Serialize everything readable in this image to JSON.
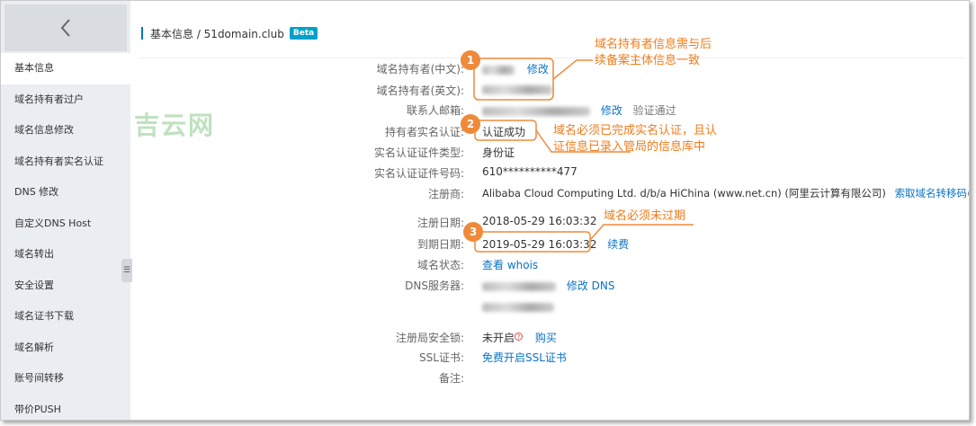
{
  "sidebar": {
    "back_icon": "chevron-left-icon",
    "items": [
      {
        "label": "基本信息"
      },
      {
        "label": "域名持有者过户"
      },
      {
        "label": "域名信息修改"
      },
      {
        "label": "域名持有者实名认证"
      },
      {
        "label": "DNS 修改"
      },
      {
        "label": "自定义DNS Host"
      },
      {
        "label": "域名转出"
      },
      {
        "label": "安全设置"
      },
      {
        "label": "域名证书下载"
      },
      {
        "label": "域名解析"
      },
      {
        "label": "账号间转移"
      },
      {
        "label": "带价PUSH"
      }
    ],
    "collapse_icon": "collapse-icon"
  },
  "watermark": "吉云网",
  "breadcrumb": {
    "text": "基本信息 / 51domain.club",
    "badge": "Beta"
  },
  "fields": {
    "owner_cn": {
      "label": "域名持有者(中文):",
      "action": "修改"
    },
    "owner_en": {
      "label": "域名持有者(英文):"
    },
    "email": {
      "label": "联系人邮箱:",
      "action": "修改",
      "status": "验证通过"
    },
    "realname": {
      "label": "持有者实名认证:",
      "value": "认证成功"
    },
    "cert_type": {
      "label": "实名认证证件类型:",
      "value": "身份证"
    },
    "cert_no": {
      "label": "实名认证证件号码:",
      "value": "610**********477"
    },
    "registrar": {
      "label": "注册商:",
      "value": "Alibaba Cloud Computing Ltd. d/b/a HiChina (www.net.cn) (阿里云计算有限公司)",
      "action": "索取域名转移码"
    },
    "reg_date": {
      "label": "注册日期:",
      "value": "2018-05-29 16:03:32"
    },
    "exp_date": {
      "label": "到期日期:",
      "value": "2019-05-29 16:03:32",
      "action": "续费"
    },
    "status": {
      "label": "域名状态:",
      "action": "查看 whois"
    },
    "dns": {
      "label": "DNS服务器:",
      "action": "修改 DNS"
    },
    "lock": {
      "label": "注册局安全锁:",
      "value": "未开启",
      "action": "购买"
    },
    "ssl": {
      "label": "SSL证书:",
      "action": "免费开启SSL证书"
    },
    "note": {
      "label": "备注:"
    }
  },
  "annotations": [
    {
      "number": "1",
      "text_line1": "域名持有者信息需与后",
      "text_line2": "续备案主体信息一致"
    },
    {
      "number": "2",
      "text_line1": "域名必须已完成实名认证，且认",
      "text_line2": "证信息已录入管局的信息库中"
    },
    {
      "number": "3",
      "text_line1": "域名必须未过期"
    }
  ],
  "colors": {
    "accent": "#ef8a3b",
    "link": "#0a73c6",
    "beta": "#00a2ca",
    "sidebar_bg": "#eaedf1"
  }
}
